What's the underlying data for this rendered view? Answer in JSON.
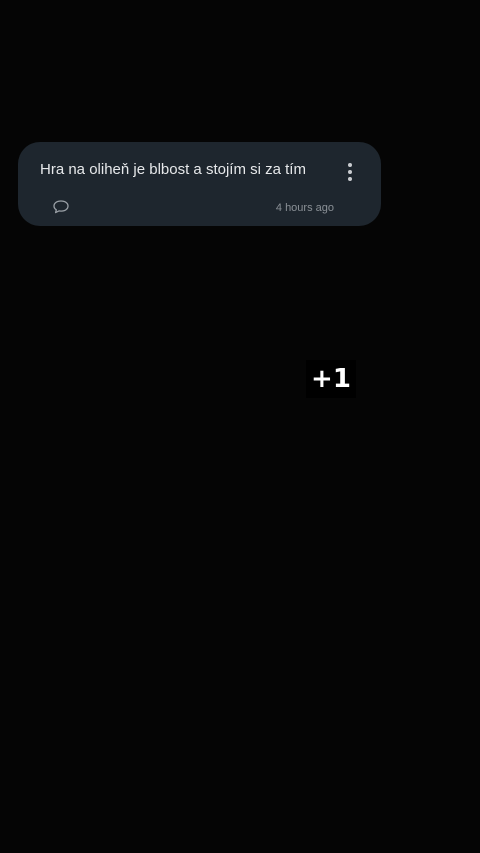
{
  "post": {
    "text": "Hra na oliheň je blbost a stojím si za tím",
    "timestamp": "4 hours ago",
    "comment_icon": "comment-bubble-icon",
    "more_icon": "more-vertical-icon"
  },
  "vote_badge": {
    "label": "+1"
  },
  "colors": {
    "background": "#050505",
    "card": "#1e262e",
    "text": "#e6e8ea",
    "muted": "#8a9096"
  }
}
